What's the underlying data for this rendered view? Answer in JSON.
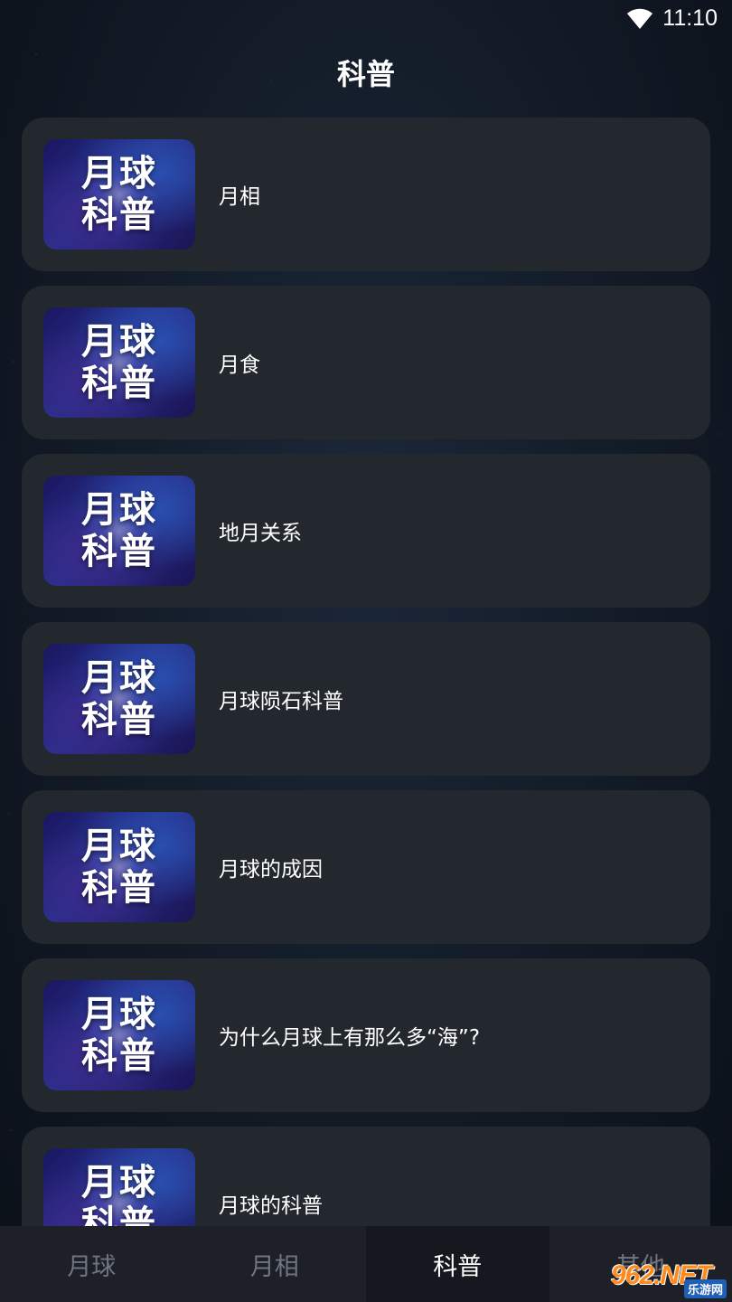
{
  "status_bar": {
    "time": "11:10",
    "wifi_icon": "wifi-icon"
  },
  "header": {
    "title": "科普"
  },
  "thumbnail": {
    "line1": "月球",
    "line2": "科普"
  },
  "items": [
    {
      "label": "月相"
    },
    {
      "label": "月食"
    },
    {
      "label": "地月关系"
    },
    {
      "label": "月球陨石科普"
    },
    {
      "label": "月球的成因"
    },
    {
      "label": "为什么月球上有那么多“海”?"
    },
    {
      "label": "月球的科普"
    }
  ],
  "tabs": [
    {
      "label": "月球",
      "active": false
    },
    {
      "label": "月相",
      "active": false
    },
    {
      "label": "科普",
      "active": true
    },
    {
      "label": "其他",
      "active": false
    }
  ],
  "watermark": {
    "main": "962",
    "suffix": ".NET",
    "sub": "乐游网"
  },
  "colors": {
    "card_bg": "#23272e",
    "tabbar_bg": "#1d2027",
    "tab_inactive": "#6f7480",
    "tab_active": "#ffffff"
  }
}
